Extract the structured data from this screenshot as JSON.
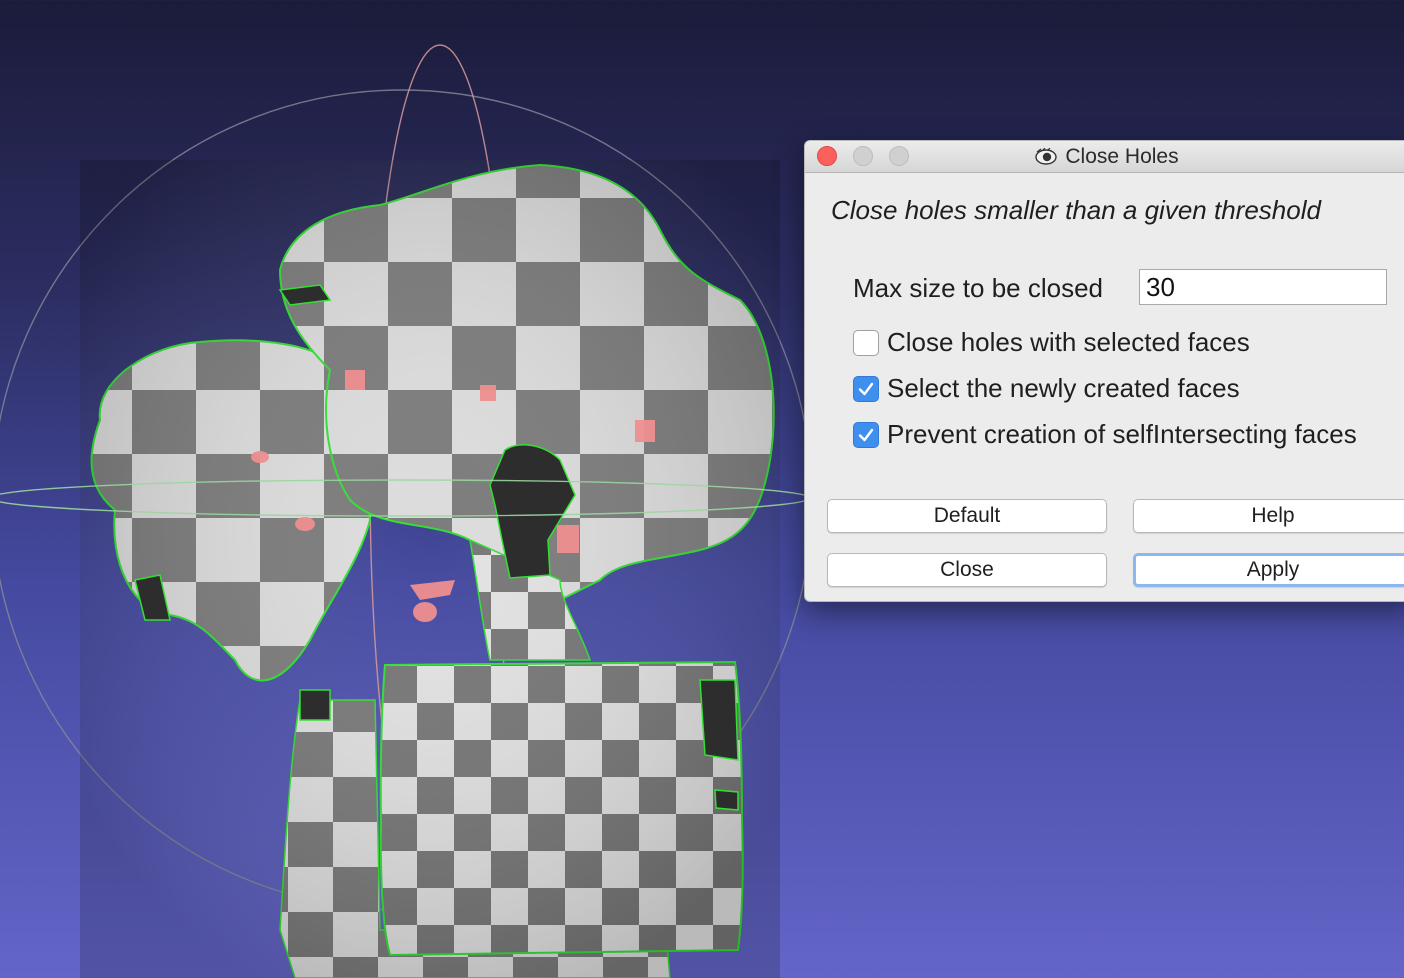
{
  "dialog": {
    "title": "Close Holes",
    "app_icon": "meshlab-eye-icon",
    "description": "Close holes smaller than a given threshold",
    "max_size_label": "Max size to be closed",
    "max_size_value": "30",
    "options": [
      {
        "label": "Close holes with selected faces",
        "checked": false
      },
      {
        "label": "Select the newly created faces",
        "checked": true
      },
      {
        "label": "Prevent creation of selfIntersecting faces",
        "checked": true
      }
    ],
    "buttons": {
      "default": "Default",
      "help": "Help",
      "close": "Close",
      "apply": "Apply"
    }
  },
  "colors": {
    "checkbox_checked": "#3f8fef",
    "close_traffic": "#fc605c",
    "mesh_boundary": "#32e032",
    "selected_faces": "#ef8f8f"
  }
}
